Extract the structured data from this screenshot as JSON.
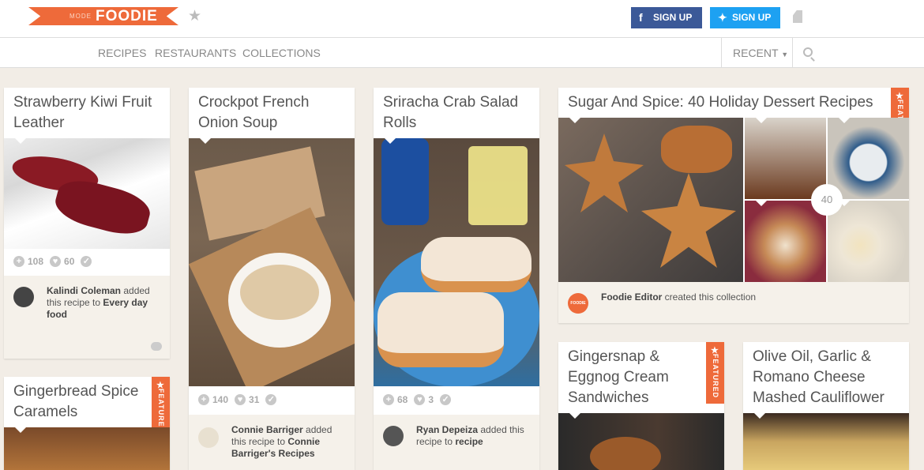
{
  "header": {
    "logo_mode": "MODE",
    "logo_word": "FOODIE",
    "facebook_label": "SIGN UP",
    "twitter_label": "SIGN UP"
  },
  "nav": {
    "links": [
      "RECIPES",
      "RESTAURANTS",
      "COLLECTIONS"
    ],
    "recent": "RECENT"
  },
  "cards": [
    {
      "title": "Strawberry Kiwi Fruit Leather",
      "adds": "108",
      "likes": "60",
      "user": "Kalindi Coleman",
      "action": "added this recipe to",
      "target": "Every day food"
    },
    {
      "title": "Crockpot French Onion Soup",
      "adds": "140",
      "likes": "31",
      "user": "Connie Barriger",
      "action": "added this recipe to",
      "target": "Connie Barriger's Recipes"
    },
    {
      "title": "Sriracha Crab Salad Rolls",
      "adds": "68",
      "likes": "3",
      "user": "Ryan Depeiza",
      "action": "added this recipe to",
      "target": "recipe"
    },
    {
      "title": "Sugar And Spice: 40 Holiday Dessert Recipes",
      "count": "40",
      "user": "Foodie Editor",
      "action": "created this collection",
      "featured": "FEATURED",
      "avatar_text": "FOODIE"
    },
    {
      "title": "Gingerbread Spice Caramels",
      "featured": "FEATURED"
    },
    {
      "title": "Gingersnap & Eggnog Cream Sandwiches",
      "featured": "FEATURED"
    },
    {
      "title": "Olive Oil, Garlic & Romano Cheese Mashed Cauliflower"
    }
  ]
}
